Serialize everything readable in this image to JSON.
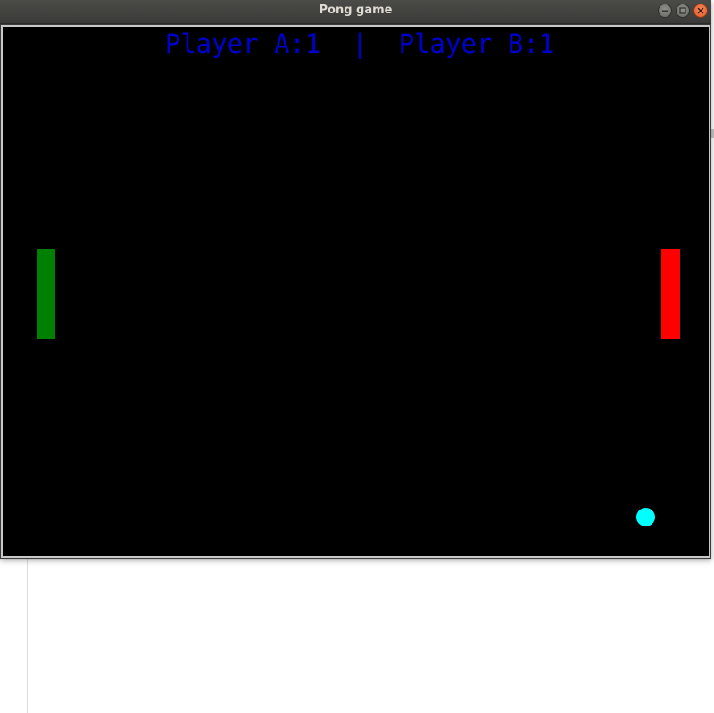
{
  "window": {
    "title": "Pong game"
  },
  "window_controls": {
    "minimize_icon": "minimize-icon",
    "maximize_icon": "maximize-icon",
    "close_icon": "close-icon"
  },
  "game": {
    "score_text": "Player A:1  |  Player B:1",
    "player_a_score": 1,
    "player_b_score": 1,
    "background_color": "#000000",
    "score_color": "#0000cd",
    "left_paddle_color": "#008000",
    "right_paddle_color": "#ff0000",
    "ball_color": "#00ffff"
  }
}
